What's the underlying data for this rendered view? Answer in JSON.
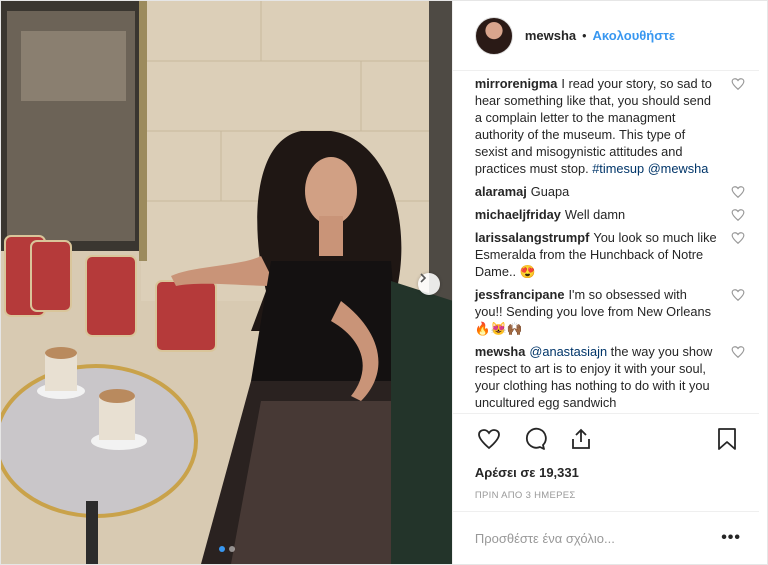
{
  "post": {
    "username": "mewsha",
    "separator": "•",
    "follow_label": "Ακολουθήστε"
  },
  "comments": [
    {
      "user": "mirrorenigma",
      "text": "I read your story, so sad to hear something like that, you should send a complain letter to the managment authority of the museum. This type of sexist and misogynistic attitudes and practices must stop.",
      "hashtag": "#timesup",
      "mention": "@mewsha"
    },
    {
      "user": "alaramaj",
      "text": "Guapa"
    },
    {
      "user": "michaeljfriday",
      "text": "Well damn"
    },
    {
      "user": "larissalangstrumpf",
      "text": "You look so much like Esmeralda from the Hunchback of Notre Dame.. 😍"
    },
    {
      "user": "jessfrancipane",
      "text": "I'm so obsessed with you!! Sending you love from New Orleans 🔥😻🙌🏾"
    },
    {
      "user": "mewsha",
      "mention": "@anastasiajn",
      "text": "the way you show respect to art is to enjoy it with your soul, your clothing has nothing to do with it you uncultured egg sandwich"
    }
  ],
  "likes_label": "Αρέσει σε 19,331",
  "time_label": "ΠΡΙΝ ΑΠΟ 3 ΗΜΕΡΕΣ",
  "comment_input": {
    "placeholder": "Προσθέστε ένα σχόλιο..."
  },
  "more_label": "•••",
  "icons": {
    "like": "heart-icon",
    "comment": "comment-icon",
    "share": "share-icon",
    "save": "bookmark-icon",
    "next": "chevron-right-icon"
  },
  "colors": {
    "link": "#3897f0",
    "text": "#262626",
    "muted": "#999999"
  }
}
